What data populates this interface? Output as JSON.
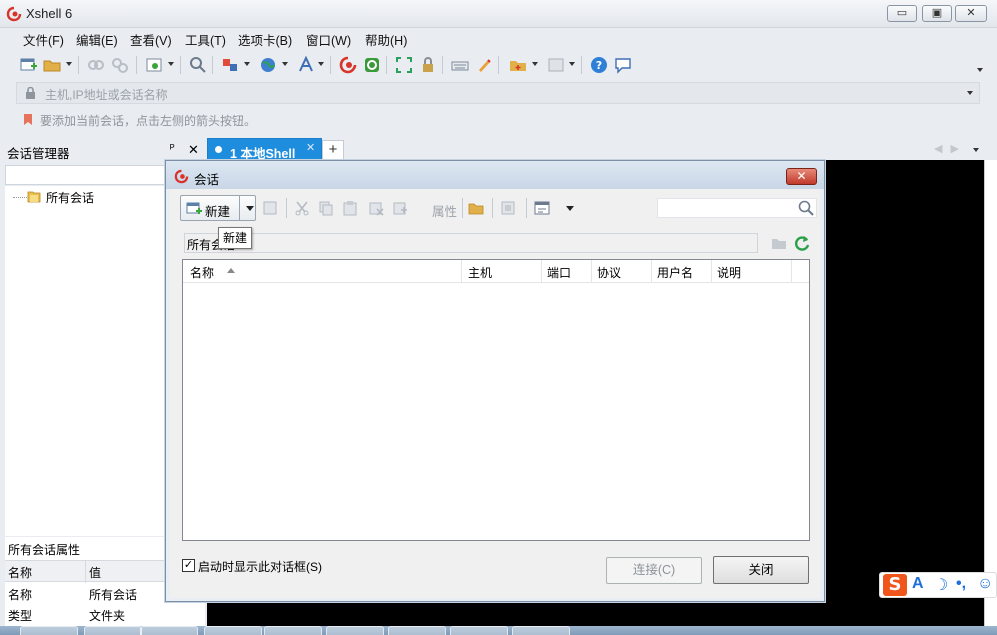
{
  "app": {
    "title": "Xshell 6"
  },
  "window_controls": {
    "minimize": "▭",
    "maximize": "▣",
    "close": "✕"
  },
  "menu": [
    "文件(F)",
    "编辑(E)",
    "查看(V)",
    "工具(T)",
    "选项卡(B)",
    "窗口(W)",
    "帮助(H)"
  ],
  "address": {
    "placeholder": "主机,IP地址或会话名称"
  },
  "hint": "要添加当前会话，点击左侧的箭头按钮。",
  "session_manager": {
    "title": "会话管理器",
    "tree": [
      {
        "label": "所有会话"
      }
    ],
    "properties": {
      "title": "所有会话属性",
      "headers": [
        "名称",
        "值"
      ],
      "rows": [
        [
          "名称",
          "所有会话"
        ],
        [
          "类型",
          "文件夹"
        ]
      ]
    }
  },
  "tabs": [
    {
      "number": "1",
      "label": "本地Shell",
      "active": true
    }
  ],
  "tab_add": "+",
  "dialog": {
    "title": "会话",
    "new_label": "新建",
    "props_label": "属性",
    "tooltip": "新建",
    "path": "所有会话",
    "columns": [
      "名称",
      "主机",
      "端口",
      "协议",
      "用户名",
      "说明"
    ],
    "rows": [],
    "startup_checkbox": {
      "label": "启动时显示此对话框(S)",
      "checked": true
    },
    "connect_label": "连接(C)",
    "close_label": "关闭"
  },
  "colors": {
    "accent": "#1f8dde",
    "logo": "#d9342b",
    "terminal_bg": "#000000"
  }
}
